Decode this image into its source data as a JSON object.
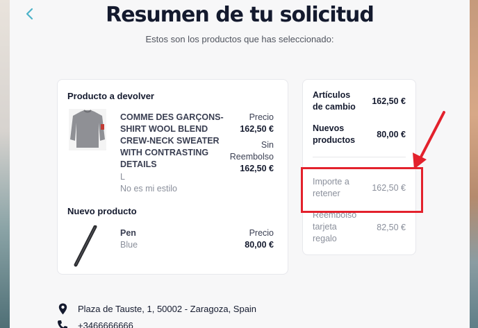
{
  "header": {
    "back_icon": "chevron-left-icon",
    "title": "Resumen de tu solicitud",
    "subtitle": "Estos son los productos que has seleccionado:"
  },
  "return_section": {
    "title": "Producto a devolver",
    "product": {
      "name_lines": [
        "COMME DES GARÇONS-",
        "SHIRT WOOL BLEND",
        "CREW-NECK SWEATER",
        "WITH CONTRASTING",
        "DETAILS"
      ],
      "size": "L",
      "reason": "No es mi estilo",
      "price_label": "Precio",
      "price_value": "162,50 €",
      "refund_label_1": "Sin",
      "refund_label_2": "Reembolso",
      "refund_value": "162,50 €"
    }
  },
  "new_section": {
    "title": "Nuevo producto",
    "product": {
      "name": "Pen",
      "color": "Blue",
      "price_label": "Precio",
      "price_value": "80,00 €"
    }
  },
  "summary": {
    "exchange_label_1": "Artículos",
    "exchange_label_2": "de cambio",
    "exchange_value": "162,50 €",
    "new_label_1": "Nuevos",
    "new_label_2": "productos",
    "new_value": "80,00 €",
    "retain_label_1": "Importe a",
    "retain_label_2": "retener",
    "retain_value": "162,50 €",
    "giftcard_label_1": "Reembolso",
    "giftcard_label_2": "tarjeta",
    "giftcard_label_3": "regalo",
    "giftcard_value": "82,50 €"
  },
  "address": {
    "icon": "location-pin-icon",
    "text": "Plaza de Tauste, 1, 50002 - Zaragoza, Spain"
  },
  "phone": {
    "icon": "phone-icon",
    "text": "+3466666666"
  },
  "colors": {
    "accent": "#4db3c9",
    "highlight": "#e3212c",
    "title": "#141a2e"
  }
}
